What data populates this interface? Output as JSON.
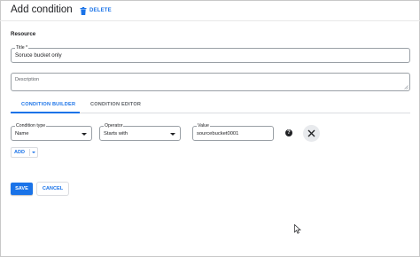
{
  "dialog": {
    "title": "Add condition",
    "delete_label": "DELETE"
  },
  "resource": {
    "section_label": "Resource"
  },
  "title_field": {
    "label": "Title *",
    "value": "Soruce bucket only"
  },
  "description_field": {
    "placeholder": "Description",
    "value": ""
  },
  "tabs": [
    {
      "label": "CONDITION BUILDER",
      "active": true
    },
    {
      "label": "CONDITION EDITOR",
      "active": false
    }
  ],
  "condition_row": {
    "condition_type": {
      "label": "Condition type",
      "value": "Name"
    },
    "operator": {
      "label": "Operator",
      "value": "Starts with"
    },
    "value": {
      "label": "Value",
      "value": "sourcebucket0001"
    }
  },
  "add_button": {
    "label": "ADD"
  },
  "actions": {
    "save_label": "SAVE",
    "cancel_label": "CANCEL"
  },
  "colors": {
    "accent": "#1a73e8",
    "text": "#202124",
    "border": "#9aa0a6"
  },
  "icons": {
    "delete": "trash-icon",
    "help": "help-icon",
    "remove": "close-icon",
    "cursor": "mouse-pointer-icon"
  }
}
